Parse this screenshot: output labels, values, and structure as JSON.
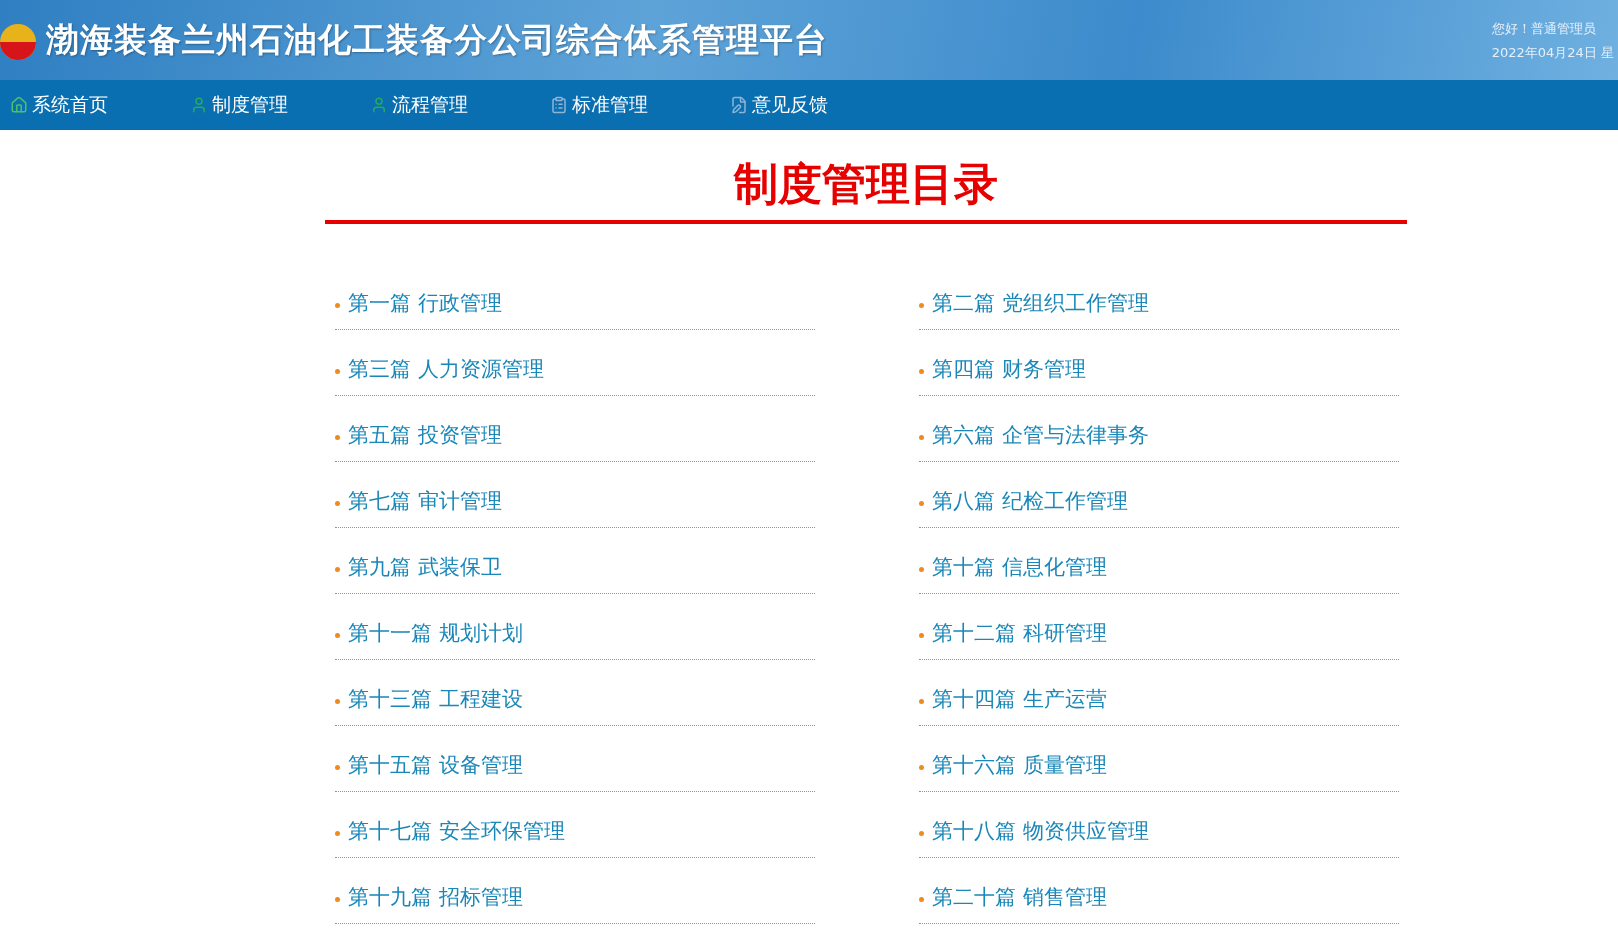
{
  "header": {
    "title": "渤海装备兰州石油化工装备分公司综合体系管理平台",
    "greeting": "您好！普通管理员",
    "date": "2022年04月24日 星"
  },
  "nav": [
    {
      "label": "系统首页"
    },
    {
      "label": "制度管理"
    },
    {
      "label": "流程管理"
    },
    {
      "label": "标准管理"
    },
    {
      "label": "意见反馈"
    }
  ],
  "page_title": "制度管理目录",
  "catalog": [
    "第一篇 行政管理",
    "第二篇 党组织工作管理",
    "第三篇 人力资源管理",
    "第四篇 财务管理",
    "第五篇 投资管理",
    "第六篇 企管与法律事务",
    "第七篇 审计管理",
    "第八篇 纪检工作管理",
    "第九篇 武装保卫",
    "第十篇 信息化管理",
    "第十一篇 规划计划",
    "第十二篇 科研管理",
    "第十三篇 工程建设",
    "第十四篇 生产运营",
    "第十五篇 设备管理",
    "第十六篇 质量管理",
    "第十七篇 安全环保管理",
    "第十八篇 物资供应管理",
    "第十九篇 招标管理",
    "第二十篇 销售管理"
  ]
}
